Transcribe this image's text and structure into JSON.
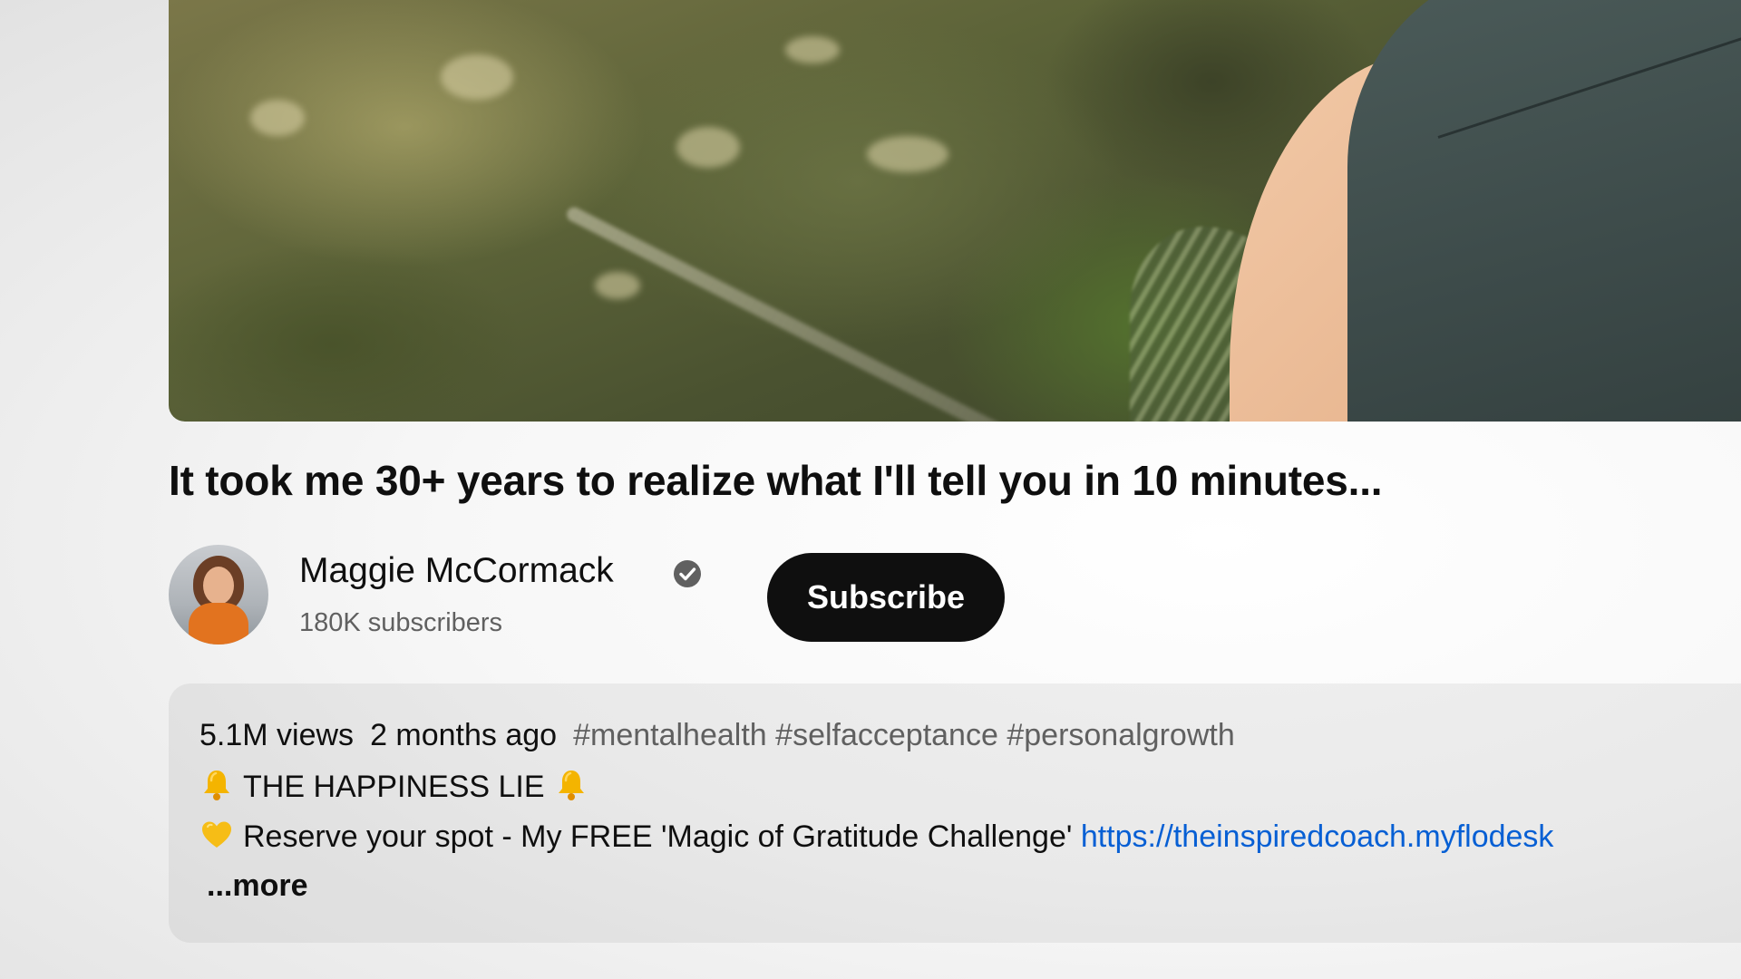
{
  "video": {
    "title": "It took me 30+ years to realize what I'll tell you in 10 minutes..."
  },
  "channel": {
    "name": "Maggie McCormack",
    "verified": true,
    "subscribers": "180K subscribers",
    "subscribe_label": "Subscribe"
  },
  "description": {
    "views": "5.1M views",
    "age": "2 months ago",
    "hashtags": [
      "#mentalhealth",
      "#selfacceptance",
      "#personalgrowth"
    ],
    "line2_text": "THE HAPPINESS LIE",
    "line3_text": "Reserve your spot - My FREE 'Magic of Gratitude Challenge'",
    "line3_link": "https://theinspiredcoach.myflodesk",
    "more_label": "...more"
  },
  "colors": {
    "text_primary": "#0f0f0f",
    "text_secondary": "#606060",
    "link": "#065fd4",
    "subscribe_bg": "#0f0f0f"
  },
  "icons": {
    "verified": "verified-check-icon",
    "bell": "bell-icon",
    "heart": "yellow-heart-icon"
  }
}
